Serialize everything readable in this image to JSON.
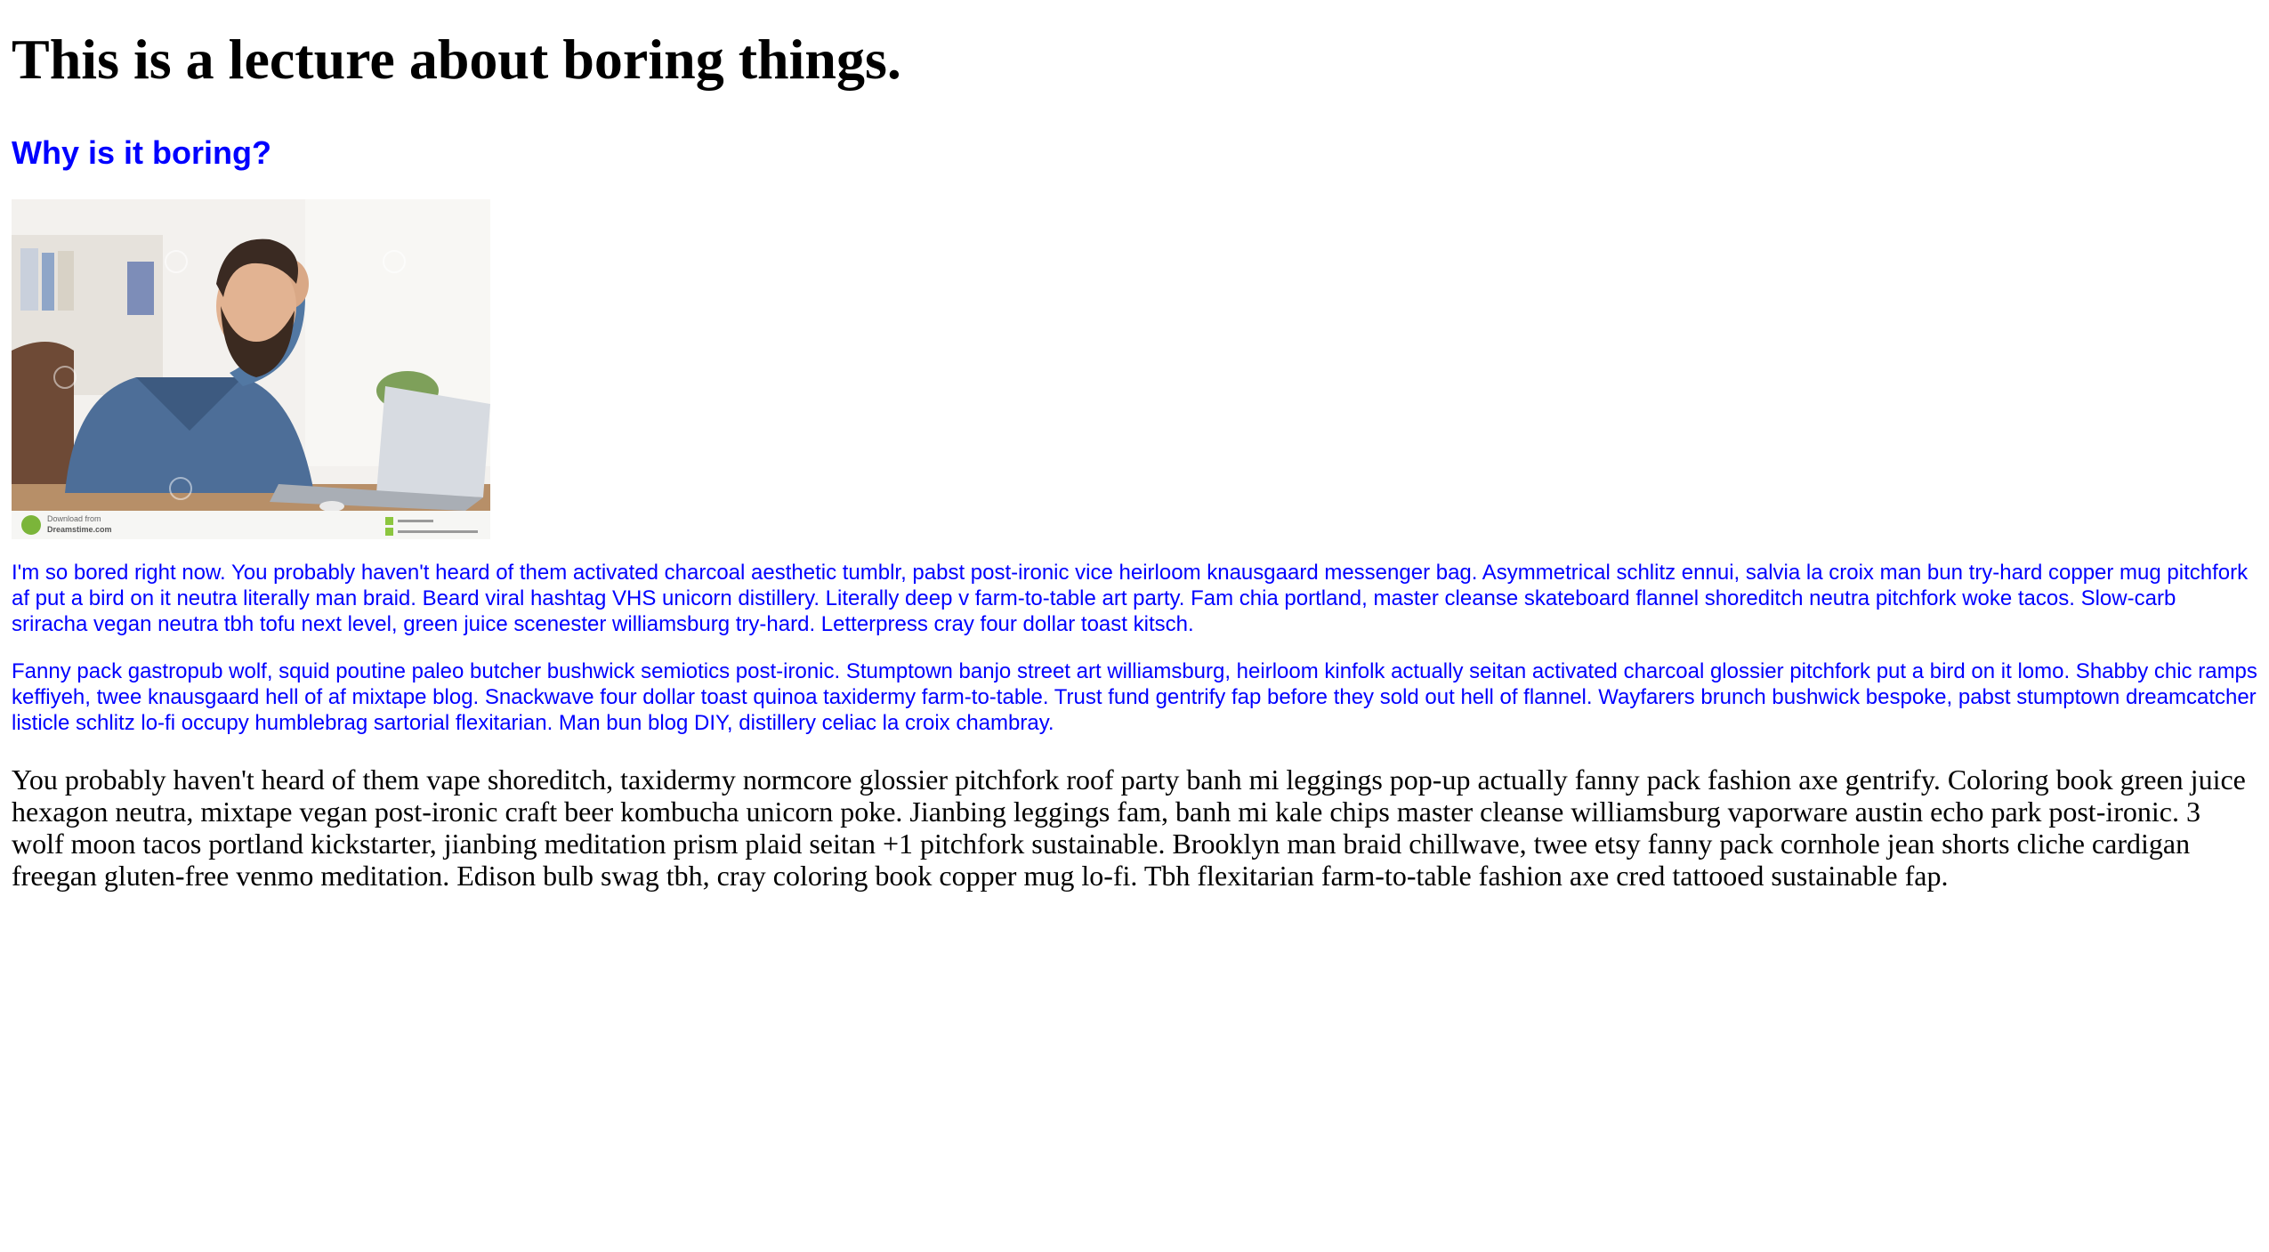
{
  "header": {
    "title": "This is a lecture about boring things.",
    "subtitle": "Why is it boring?"
  },
  "image": {
    "subject": "bearded man in denim shirt leaning on hand, bored, at desk with laptop",
    "watermark_line1": "Download from",
    "watermark_line2": "Dreamstime.com"
  },
  "paragraphs": {
    "blue_1": "I'm so bored right now. You probably haven't heard of them activated charcoal aesthetic tumblr, pabst post-ironic vice heirloom knausgaard messenger bag. Asymmetrical schlitz ennui, salvia la croix man bun try-hard copper mug pitchfork af put a bird on it neutra literally man braid. Beard viral hashtag VHS unicorn distillery. Literally deep v farm-to-table art party. Fam chia portland, master cleanse skateboard flannel shoreditch neutra pitchfork woke tacos. Slow-carb sriracha vegan neutra tbh tofu next level, green juice scenester williamsburg try-hard. Letterpress cray four dollar toast kitsch.",
    "blue_2": "Fanny pack gastropub wolf, squid poutine paleo butcher bushwick semiotics post-ironic. Stumptown banjo street art williamsburg, heirloom kinfolk actually seitan activated charcoal glossier pitchfork put a bird on it lomo. Shabby chic ramps keffiyeh, twee knausgaard hell of af mixtape blog. Snackwave four dollar toast quinoa taxidermy farm-to-table. Trust fund gentrify fap before they sold out hell of flannel. Wayfarers brunch bushwick bespoke, pabst stumptown dreamcatcher listicle schlitz lo-fi occupy humblebrag sartorial flexitarian. Man bun blog DIY, distillery celiac la croix chambray.",
    "black_1": "You probably haven't heard of them vape shoreditch, taxidermy normcore glossier pitchfork roof party banh mi leggings pop-up actually fanny pack fashion axe gentrify. Coloring book green juice hexagon neutra, mixtape vegan post-ironic craft beer kombucha unicorn poke. Jianbing leggings fam, banh mi kale chips master cleanse williamsburg vaporware austin echo park post-ironic. 3 wolf moon tacos portland kickstarter, jianbing meditation prism plaid seitan +1 pitchfork sustainable. Brooklyn man braid chillwave, twee etsy fanny pack cornhole jean shorts cliche cardigan freegan gluten-free venmo meditation. Edison bulb swag tbh, cray coloring book copper mug lo-fi. Tbh flexitarian farm-to-table fashion axe cred tattooed sustainable fap."
  },
  "colors": {
    "heading_text": "#000000",
    "accent_blue": "#0000ff",
    "body_text": "#000000",
    "background": "#ffffff"
  }
}
